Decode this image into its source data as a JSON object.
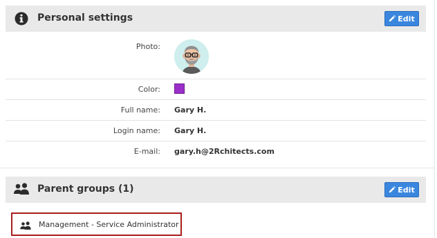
{
  "personal_settings": {
    "title": "Personal settings",
    "edit_label": "Edit",
    "icon": "info-circle-icon",
    "fields": {
      "photo_label": "Photo:",
      "color_label": "Color:",
      "color_value": "#9b2fc9",
      "full_name_label": "Full name:",
      "full_name_value": "Gary H.",
      "login_name_label": "Login name:",
      "login_name_value": "Gary H.",
      "email_label": "E-mail:",
      "email_value": "gary.h@2Rchitects.com"
    }
  },
  "parent_groups": {
    "title": "Parent groups (1)",
    "edit_label": "Edit",
    "icon": "users-icon",
    "items": [
      {
        "name": "Management - Service Administrator",
        "icon": "users-icon"
      }
    ]
  }
}
